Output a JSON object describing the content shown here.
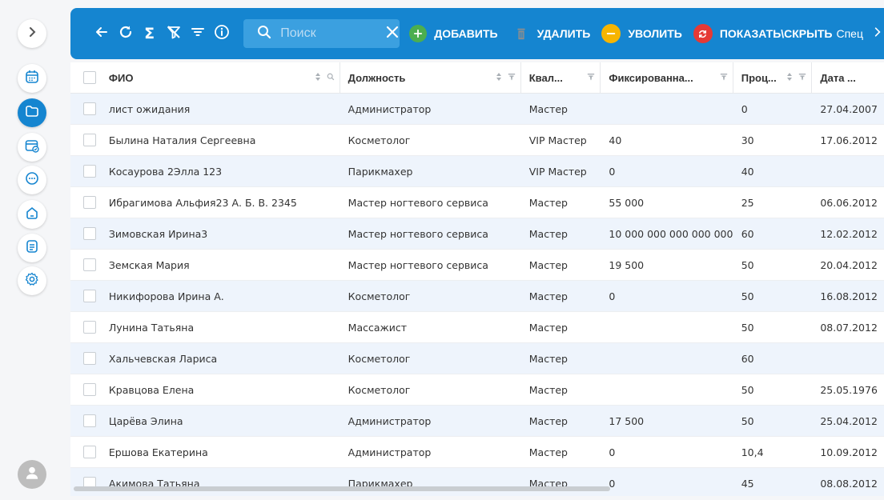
{
  "toolbar": {
    "search_placeholder": "Поиск",
    "search_value": "",
    "add_label": "ДОБАВИТЬ",
    "delete_label": "УДАЛИТЬ",
    "fire_label": "УВОЛИТЬ",
    "toggle_label": "ПОКАЗАТЬ\\СКРЫТЬ",
    "toggle_suffix": "Спец",
    "colors": {
      "bar": "#1585d0",
      "add": "#4cae4f",
      "fire": "#f7b500",
      "toggle": "#e53935"
    }
  },
  "grid": {
    "columns": {
      "fio": "ФИО",
      "position": "Должность",
      "qualification": "Квал...",
      "fixed": "Фиксированна...",
      "percent": "Проц...",
      "date": "Дата ..."
    },
    "rows": [
      {
        "fio": "лист ожидания",
        "position": "Администратор",
        "qualification": "Мастер",
        "fixed": "",
        "percent": "0",
        "date": "27.04.2007"
      },
      {
        "fio": "Былина Наталия Сергеевна",
        "position": "Косметолог",
        "qualification": "VIP Мастер",
        "fixed": "40",
        "percent": "30",
        "date": "17.06.2012"
      },
      {
        "fio": "Косаурова 2Элла 123",
        "position": "Парикмахер",
        "qualification": "VIP Мастер",
        "fixed": "0",
        "percent": "40",
        "date": ""
      },
      {
        "fio": "Ибрагимова Альфия23 А. Б. В. 2345",
        "position": "Мастер ногтевого сервиса",
        "qualification": "Мастер",
        "fixed": "55 000",
        "percent": "25",
        "date": "06.06.2012"
      },
      {
        "fio": "Зимовская Ирина3",
        "position": "Мастер ногтевого сервиса",
        "qualification": "Мастер",
        "fixed": "10 000 000 000 000 000",
        "percent": "60",
        "date": "12.02.2012"
      },
      {
        "fio": "Земская Мария",
        "position": "Мастер ногтевого сервиса",
        "qualification": "Мастер",
        "fixed": "19 500",
        "percent": "50",
        "date": "20.04.2012"
      },
      {
        "fio": "Никифорова Ирина А.",
        "position": "Косметолог",
        "qualification": "Мастер",
        "fixed": "0",
        "percent": "50",
        "date": "16.08.2012"
      },
      {
        "fio": "Лунина Татьяна",
        "position": "Массажист",
        "qualification": "Мастер",
        "fixed": "",
        "percent": "50",
        "date": "08.07.2012"
      },
      {
        "fio": "Хальчевская Лариса",
        "position": "Косметолог",
        "qualification": "Мастер",
        "fixed": "",
        "percent": "60",
        "date": ""
      },
      {
        "fio": "Кравцова Елена",
        "position": "Косметолог",
        "qualification": "Мастер",
        "fixed": "",
        "percent": "50",
        "date": "25.05.1976"
      },
      {
        "fio": "Царёва Элина",
        "position": "Администратор",
        "qualification": "Мастер",
        "fixed": "17 500",
        "percent": "50",
        "date": "25.04.2012"
      },
      {
        "fio": "Ершова Екатерина",
        "position": "Администратор",
        "qualification": "Мастер",
        "fixed": "0",
        "percent": "10,4",
        "date": "10.09.2012"
      },
      {
        "fio": "Акимова Татьяна",
        "position": "Парикмахер",
        "qualification": "Мастер",
        "fixed": "0",
        "percent": "45",
        "date": "08.08.2012"
      }
    ]
  }
}
